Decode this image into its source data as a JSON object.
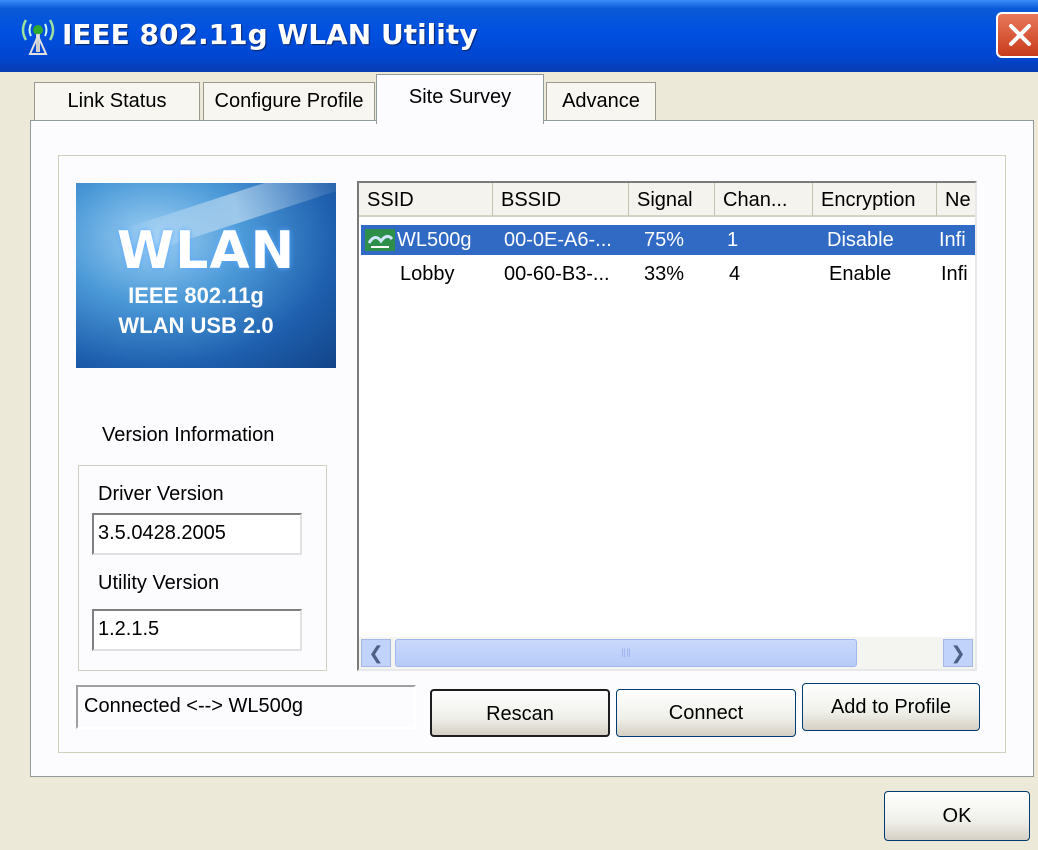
{
  "window": {
    "title": "IEEE 802.11g WLAN Utility",
    "icon": "antenna-icon",
    "close_icon": "close-icon"
  },
  "tabs": [
    {
      "label": "Link Status",
      "active": false
    },
    {
      "label": "Configure Profile",
      "active": false
    },
    {
      "label": "Site Survey",
      "active": true
    },
    {
      "label": "Advance",
      "active": false
    }
  ],
  "logo": {
    "title": "WLAN",
    "line1": "IEEE 802.11g",
    "line2": "WLAN USB 2.0"
  },
  "version": {
    "heading": "Version Information",
    "driver_label": "Driver Version",
    "driver_value": "3.5.0428.2005",
    "utility_label": "Utility Version",
    "utility_value": "1.2.1.5"
  },
  "survey": {
    "columns": [
      "SSID",
      "BSSID",
      "Signal",
      "Chan...",
      "Encryption",
      "Ne"
    ],
    "rows": [
      {
        "ssid": "WL500g",
        "bssid": "00-0E-A6-...",
        "signal": "75%",
        "channel": "1",
        "encryption": "Disable",
        "network": "Infi",
        "selected": true,
        "icon": "connected-icon"
      },
      {
        "ssid": "Lobby",
        "bssid": "00-60-B3-...",
        "signal": "33%",
        "channel": "4",
        "encryption": "Enable",
        "network": "Infi",
        "selected": false
      }
    ],
    "scroll_left_icon": "chevron-left-icon",
    "scroll_right_icon": "chevron-right-icon"
  },
  "status": "Connected <--> WL500g",
  "buttons": {
    "rescan": "Rescan",
    "connect": "Connect",
    "add_profile": "Add to Profile",
    "ok": "OK"
  },
  "colors": {
    "titlebar": "#0050E0",
    "selection": "#316AC5",
    "face": "#ECE9D8",
    "close": "#C83C1C"
  }
}
